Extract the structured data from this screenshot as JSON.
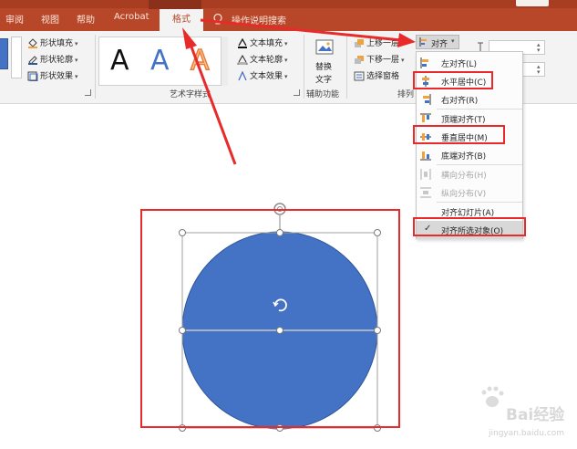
{
  "tabs": {
    "review": "审阅",
    "view": "视图",
    "help": "帮助",
    "acrobat": "Acrobat",
    "format": "格式",
    "tell_me": "操作说明搜索"
  },
  "ribbon": {
    "shape_fill": "形状填充",
    "shape_outline": "形状轮廓",
    "shape_effects": "形状效果",
    "wordart_styles_label": "艺术字样式",
    "wordart_letter": "A",
    "text_fill": "文本填充",
    "text_outline": "文本轮廓",
    "text_effects": "文本效果",
    "alt_text_line1": "替换",
    "alt_text_line2": "文字",
    "accessibility_label": "辅助功能",
    "bring_forward": "上移一层",
    "send_backward": "下移一层",
    "selection_pane": "选择窗格",
    "arrange_label": "排列",
    "align_button": "对齐"
  },
  "align_menu": {
    "items": [
      {
        "label": "左对齐(L)",
        "disabled": false
      },
      {
        "label": "水平居中(C)",
        "disabled": false
      },
      {
        "label": "右对齐(R)",
        "disabled": false
      },
      {
        "label": "顶端对齐(T)",
        "disabled": false
      },
      {
        "label": "垂直居中(M)",
        "disabled": false
      },
      {
        "label": "底端对齐(B)",
        "disabled": false
      },
      {
        "label": "横向分布(H)",
        "disabled": true
      },
      {
        "label": "纵向分布(V)",
        "disabled": true
      },
      {
        "label": "对齐幻灯片(A)",
        "disabled": false
      },
      {
        "label": "对齐所选对象(O)",
        "disabled": false,
        "checked": true
      }
    ],
    "check_mark": "✓"
  },
  "colors": {
    "ribbon_accent": "#b8472a",
    "shape_fill": "#4472c4",
    "annotation_red": "#e82a2a"
  },
  "watermark": {
    "text": "Bai经验",
    "url": "jingyan.baidu.com"
  }
}
